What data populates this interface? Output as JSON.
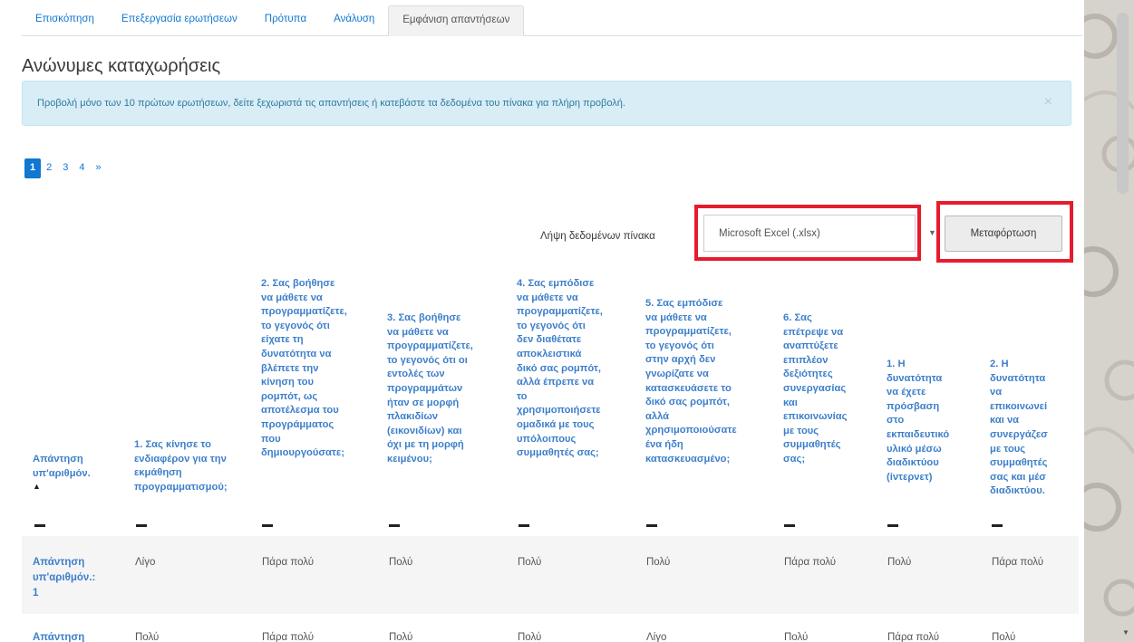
{
  "tabs": [
    "Επισκόπηση",
    "Επεξεργασία ερωτήσεων",
    "Πρότυπα",
    "Ανάλυση",
    "Εμφάνιση απαντήσεων"
  ],
  "heading": "Ανώνυμες καταχωρήσεις",
  "alert": {
    "text": "Προβολή μόνο των 10 πρώτων ερωτήσεων, δείτε ξεχωριστά τις απαντήσεις ή κατεβάστε τα δεδομένα του πίνακα για πλήρη προβολή.",
    "close": "×"
  },
  "pagination": {
    "pages": [
      "1",
      "2",
      "3",
      "4"
    ],
    "next": "»",
    "current": "1"
  },
  "download": {
    "label": "Λήψη δεδομένων πίνακα",
    "format": "Microsoft Excel (.xlsx)",
    "button": "Μεταφόρτωση"
  },
  "table": {
    "sort_icon": "▲",
    "headers": [
      [
        "Απάντηση",
        "υπ'αριθμόν."
      ],
      [
        "1. Σας κίνησε το",
        "ενδιαφέρον για την",
        "εκμάθηση",
        "προγραμματισμού;"
      ],
      [
        "2. Σας βοήθησε",
        "να μάθετε να",
        "προγραμματίζετε,",
        "το γεγονός ότι",
        "είχατε τη",
        "δυνατότητα να",
        "βλέπετε την",
        "κίνηση του",
        "ρομπότ, ως",
        "αποτέλεσμα του",
        "προγράμματος",
        "που",
        "δημιουργούσατε;"
      ],
      [
        "3. Σας βοήθησε",
        "να μάθετε να",
        "προγραμματίζετε,",
        "το γεγονός ότι οι",
        "εντολές των",
        "προγραμμάτων",
        "ήταν σε μορφή",
        "πλακιδίων",
        "(εικονιδίων) και",
        "όχι με τη μορφή",
        "κειμένου;"
      ],
      [
        "4. Σας εμπόδισε",
        "να μάθετε να",
        "προγραμματίζετε,",
        "το γεγονός ότι",
        "δεν διαθέτατε",
        "αποκλειστικά",
        "δικό σας ρομπότ,",
        "αλλά έπρεπε να",
        "το",
        "χρησιμοποιήσετε",
        "ομαδικά με τους",
        "υπόλοιπους",
        "συμμαθητές σας;"
      ],
      [
        "5. Σας εμπόδισε",
        "να μάθετε να",
        "προγραμματίζετε,",
        "το γεγονός ότι",
        "στην αρχή δεν",
        "γνωρίζατε να",
        "κατασκευάσετε το",
        "δικό σας ρομπότ,",
        "αλλά",
        "χρησιμοποιούσατε",
        "ένα ήδη",
        "κατασκευασμένο;"
      ],
      [
        "6. Σας",
        "επέτρεψε να",
        "αναπτύξετε",
        "επιπλέον",
        "δεξιότητες",
        "συνεργασίας",
        "και",
        "επικοινωνίας",
        "με τους",
        "συμμαθητές",
        "σας;"
      ],
      [
        "1. Η",
        "δυνατότητα",
        "να έχετε",
        "πρόσβαση",
        "στο",
        "εκπαιδευτικό",
        "υλικό μέσω",
        "διαδικτύου",
        "(ίντερνετ)"
      ],
      [
        "2. Η",
        "δυνατότητα",
        "να",
        "επικοινωνεί",
        "και να",
        "συνεργάζεσ",
        "με τους",
        "συμμαθητές",
        "σας και μέσ",
        "διαδικτύου."
      ]
    ],
    "rows": [
      {
        "label": [
          "Απάντηση",
          "υπ'αριθμόν.:",
          "1"
        ],
        "cells": [
          "Λίγο",
          "Πάρα πολύ",
          "Πολύ",
          "Πολύ",
          "Πολύ",
          "Πάρα πολύ",
          "Πολύ",
          "Πάρα πολύ"
        ]
      },
      {
        "label": [
          "Απάντηση"
        ],
        "cells": [
          "Πολύ",
          "Πάρα πολύ",
          "Πολύ",
          "Πολύ",
          "Λίγο",
          "Πολύ",
          "Πάρα πολύ",
          "Πολύ"
        ]
      }
    ]
  }
}
